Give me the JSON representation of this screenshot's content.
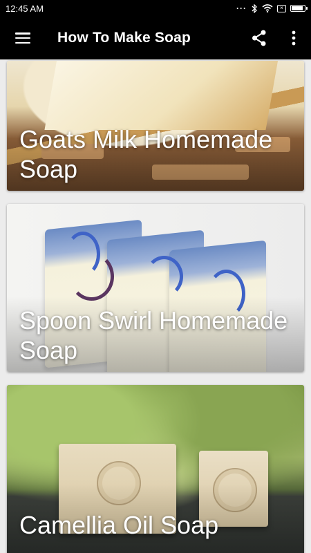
{
  "status_bar": {
    "time": "12:45 AM",
    "icons": [
      "signal-dots-icon",
      "bluetooth-icon",
      "wifi-icon",
      "sim-off-icon",
      "battery-icon"
    ],
    "battery_level": 0.9
  },
  "app_bar": {
    "title": "How To Make Soap",
    "menu_icon": "hamburger-menu-icon",
    "share_icon": "share-icon",
    "overflow_icon": "more-vert-icon"
  },
  "cards": [
    {
      "title": "Goats Milk Homemade Soap"
    },
    {
      "title": "Spoon Swirl Homemade Soap"
    },
    {
      "title": "Camellia Oil Soap"
    }
  ],
  "colors": {
    "app_bar": "#000000",
    "background": "#ececec",
    "card_text": "#ffffff"
  }
}
